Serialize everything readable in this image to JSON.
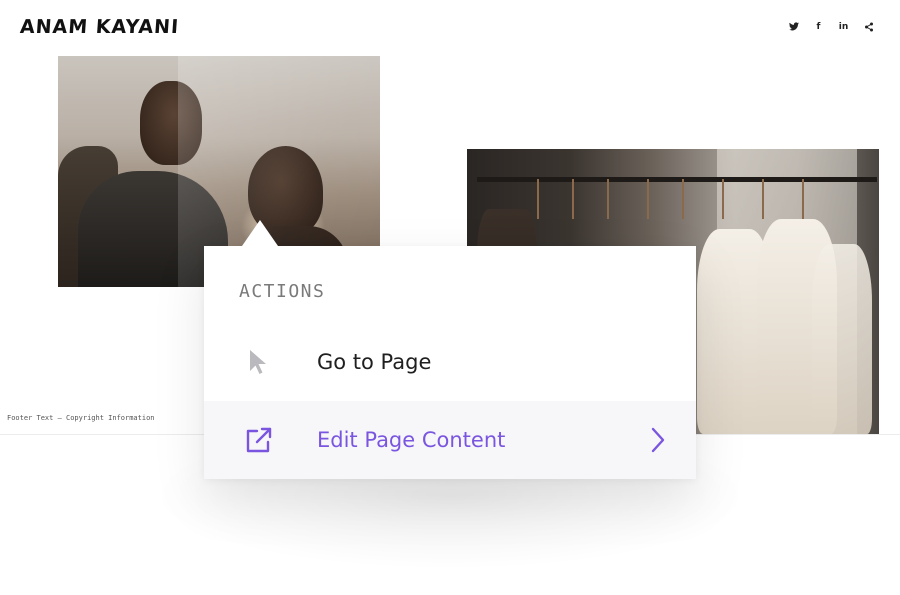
{
  "header": {
    "logo_text": "ANAM KAYANI",
    "social_icons": [
      "twitter-icon",
      "facebook-icon",
      "linkedin-icon",
      "share-icon"
    ],
    "facebook_glyph": "f",
    "linkedin_glyph": "in"
  },
  "footer": {
    "text": "Footer Text — Copyright Information"
  },
  "popup": {
    "heading": "ACTIONS",
    "actions": [
      {
        "label": "Go to Page",
        "icon": "cursor-arrow-icon",
        "color": "#1f1f1f"
      },
      {
        "label": "Edit Page Content",
        "icon": "external-link-icon",
        "color": "#7a56e0",
        "has_submenu": true
      }
    ]
  },
  "colors": {
    "accent": "#7a56e0",
    "muted_heading": "#7a7a7a",
    "highlight_row": "#f7f7f9"
  }
}
